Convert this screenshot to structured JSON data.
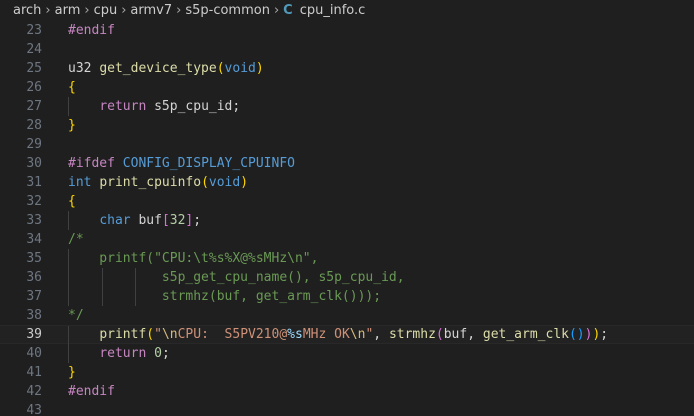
{
  "breadcrumb": {
    "items": [
      "arch",
      "arm",
      "cpu",
      "armv7",
      "s5p-common"
    ],
    "file_icon": "C",
    "file_name": "cpu_info.c",
    "separator": "›"
  },
  "editor": {
    "current_line": 39,
    "lines": [
      {
        "n": "23",
        "tokens": [
          {
            "t": "#endif",
            "c": "pre"
          }
        ]
      },
      {
        "n": "24",
        "tokens": []
      },
      {
        "n": "25",
        "tokens": [
          {
            "t": "u32 ",
            "c": "plain"
          },
          {
            "t": "get_device_type",
            "c": "fn"
          },
          {
            "t": "(",
            "c": "b1"
          },
          {
            "t": "void",
            "c": "kw"
          },
          {
            "t": ")",
            "c": "b1"
          }
        ]
      },
      {
        "n": "26",
        "tokens": [
          {
            "t": "{",
            "c": "b1"
          }
        ]
      },
      {
        "n": "27",
        "guides": [
          1
        ],
        "tokens": [
          {
            "t": "    ",
            "c": "plain"
          },
          {
            "t": "return",
            "c": "pre"
          },
          {
            "t": " s5p_cpu_id;",
            "c": "plain"
          }
        ]
      },
      {
        "n": "28",
        "tokens": [
          {
            "t": "}",
            "c": "b1"
          }
        ]
      },
      {
        "n": "29",
        "tokens": []
      },
      {
        "n": "30",
        "tokens": [
          {
            "t": "#ifdef",
            "c": "pre"
          },
          {
            "t": " ",
            "c": "plain"
          },
          {
            "t": "CONFIG_DISPLAY_CPUINFO",
            "c": "macro"
          }
        ]
      },
      {
        "n": "31",
        "tokens": [
          {
            "t": "int",
            "c": "kw"
          },
          {
            "t": " ",
            "c": "plain"
          },
          {
            "t": "print_cpuinfo",
            "c": "fn"
          },
          {
            "t": "(",
            "c": "b1"
          },
          {
            "t": "void",
            "c": "kw"
          },
          {
            "t": ")",
            "c": "b1"
          }
        ]
      },
      {
        "n": "32",
        "tokens": [
          {
            "t": "{",
            "c": "b1"
          }
        ]
      },
      {
        "n": "33",
        "guides": [
          1
        ],
        "tokens": [
          {
            "t": "    ",
            "c": "plain"
          },
          {
            "t": "char",
            "c": "kw"
          },
          {
            "t": " buf",
            "c": "plain"
          },
          {
            "t": "[",
            "c": "b2"
          },
          {
            "t": "32",
            "c": "num"
          },
          {
            "t": "]",
            "c": "b2"
          },
          {
            "t": ";",
            "c": "plain"
          }
        ]
      },
      {
        "n": "34",
        "tokens": [
          {
            "t": "/*",
            "c": "com"
          }
        ]
      },
      {
        "n": "35",
        "guides": [
          1
        ],
        "tokens": [
          {
            "t": "    printf(\"CPU:\\t%s%X@%sMHz\\n\",",
            "c": "com"
          }
        ]
      },
      {
        "n": "36",
        "guides": [
          1,
          2,
          3
        ],
        "tokens": [
          {
            "t": "            s5p_get_cpu_name(), s5p_cpu_id,",
            "c": "com"
          }
        ]
      },
      {
        "n": "37",
        "guides": [
          1,
          2,
          3
        ],
        "tokens": [
          {
            "t": "            strmhz(buf, get_arm_clk()));",
            "c": "com"
          }
        ]
      },
      {
        "n": "38",
        "tokens": [
          {
            "t": "*/",
            "c": "com"
          }
        ]
      },
      {
        "n": "39",
        "guides": [
          1
        ],
        "tokens": [
          {
            "t": "    ",
            "c": "plain"
          },
          {
            "t": "printf",
            "c": "fn"
          },
          {
            "t": "(",
            "c": "b1"
          },
          {
            "t": "\"",
            "c": "str"
          },
          {
            "t": "\\n",
            "c": "esc"
          },
          {
            "t": "CPU:  S5PV210@",
            "c": "str"
          },
          {
            "t": "%s",
            "c": "var"
          },
          {
            "t": "MHz OK",
            "c": "str"
          },
          {
            "t": "\\n",
            "c": "esc"
          },
          {
            "t": "\"",
            "c": "str"
          },
          {
            "t": ", ",
            "c": "plain"
          },
          {
            "t": "strmhz",
            "c": "fn"
          },
          {
            "t": "(",
            "c": "b2"
          },
          {
            "t": "buf, ",
            "c": "plain"
          },
          {
            "t": "get_arm_clk",
            "c": "fn"
          },
          {
            "t": "(",
            "c": "b3"
          },
          {
            "t": ")",
            "c": "b3"
          },
          {
            "t": ")",
            "c": "b2"
          },
          {
            "t": ")",
            "c": "b1"
          },
          {
            "t": ";",
            "c": "plain"
          }
        ]
      },
      {
        "n": "40",
        "guides": [
          1
        ],
        "tokens": [
          {
            "t": "    ",
            "c": "plain"
          },
          {
            "t": "return",
            "c": "pre"
          },
          {
            "t": " ",
            "c": "plain"
          },
          {
            "t": "0",
            "c": "num"
          },
          {
            "t": ";",
            "c": "plain"
          }
        ]
      },
      {
        "n": "41",
        "tokens": [
          {
            "t": "}",
            "c": "b1"
          }
        ]
      },
      {
        "n": "42",
        "tokens": [
          {
            "t": "#endif",
            "c": "pre"
          }
        ]
      },
      {
        "n": "43",
        "tokens": []
      }
    ]
  }
}
